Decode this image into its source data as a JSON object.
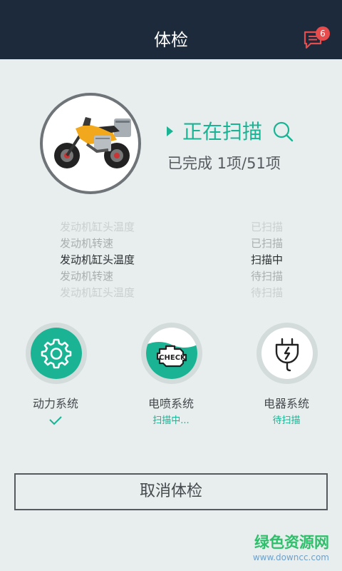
{
  "header": {
    "title": "体检",
    "message_badge": "6"
  },
  "scan": {
    "status": "正在扫描",
    "progress": "已完成 1项/51项"
  },
  "scan_list": [
    {
      "name": "发动机缸头温度",
      "state": "已扫描"
    },
    {
      "name": "发动机转速",
      "state": "已扫描"
    },
    {
      "name": "发动机缸头温度",
      "state": "扫描中"
    },
    {
      "name": "发动机转速",
      "state": "待扫描"
    },
    {
      "name": "发动机缸头温度",
      "state": "待扫描"
    }
  ],
  "systems": [
    {
      "label": "动力系统",
      "status": "done",
      "icon": "gear-icon"
    },
    {
      "label": "电喷系统",
      "status": "扫描中...",
      "icon": "engine-check-icon"
    },
    {
      "label": "电器系统",
      "status": "待扫描",
      "icon": "plug-icon"
    }
  ],
  "cancel_button": "取消体检",
  "watermark": {
    "text": "绿色资源网",
    "url": "www.downcc.com"
  },
  "colors": {
    "accent": "#1ab394",
    "header_bg": "#1d2a3c",
    "page_bg": "#e8eeee",
    "badge": "#e84b4b"
  }
}
